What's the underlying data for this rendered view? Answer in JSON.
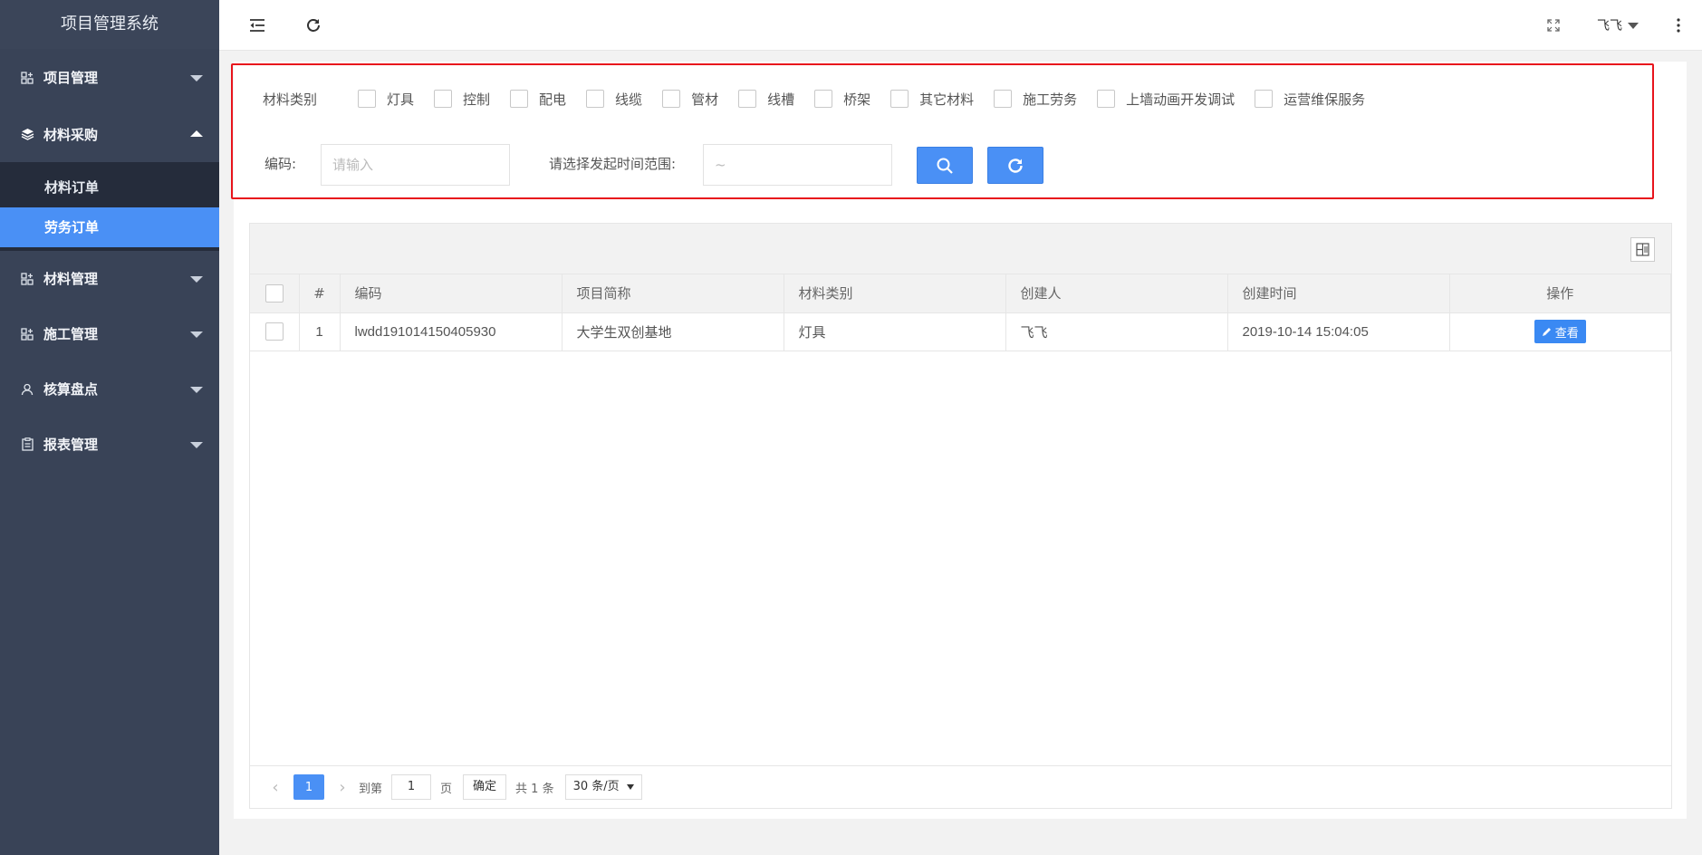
{
  "app": {
    "title": "项目管理系统"
  },
  "sidebar": {
    "items": [
      {
        "label": "项目管理",
        "icon": "grid-plus-icon"
      },
      {
        "label": "材料采购",
        "icon": "layers-icon",
        "expanded": true
      },
      {
        "label": "材料管理",
        "icon": "grid-plus-icon"
      },
      {
        "label": "施工管理",
        "icon": "grid-plus-icon"
      },
      {
        "label": "核算盘点",
        "icon": "user-icon"
      },
      {
        "label": "报表管理",
        "icon": "clipboard-icon"
      }
    ],
    "sub_items": [
      {
        "label": "材料订单",
        "active": false
      },
      {
        "label": "劳务订单",
        "active": true
      }
    ]
  },
  "topbar": {
    "user": "飞飞"
  },
  "filter": {
    "category_label": "材料类别",
    "categories": [
      "灯具",
      "控制",
      "配电",
      "线缆",
      "管材",
      "线槽",
      "桥架",
      "其它材料",
      "施工劳务",
      "上墙动画开发调试",
      "运营维保服务"
    ],
    "code_label": "编码:",
    "code_placeholder": "请输入",
    "date_label": "请选择发起时间范围:",
    "date_value": "~"
  },
  "table": {
    "headers": [
      "#",
      "编码",
      "项目简称",
      "材料类别",
      "创建人",
      "创建时间",
      "操作"
    ],
    "rows": [
      {
        "index": "1",
        "code": "lwdd191014150405930",
        "project": "大学生双创基地",
        "category": "灯具",
        "creator": "飞飞",
        "created": "2019-10-14 15:04:05",
        "action": "查看"
      }
    ]
  },
  "pager": {
    "current": "1",
    "goto_label": "到第",
    "goto_value": "1",
    "page_label": "页",
    "ok_label": "确定",
    "total": "共 1 条",
    "page_size": "30 条/页"
  },
  "colors": {
    "accent": "#4a90f5",
    "sidebar": "#394357",
    "highlight_border": "#e8141c"
  }
}
